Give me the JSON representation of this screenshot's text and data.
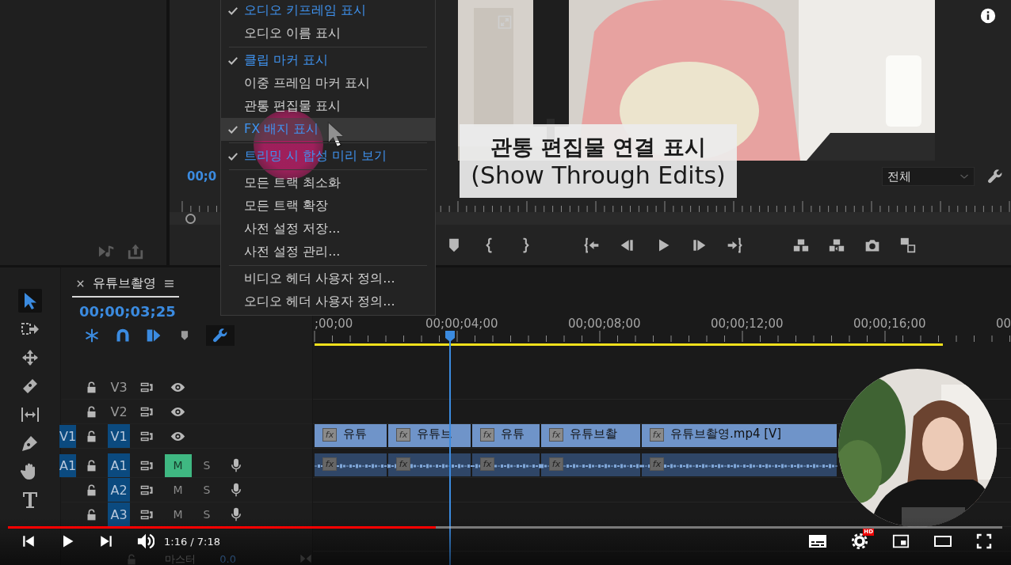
{
  "program_monitor": {
    "timecode": "00;0",
    "zoom": "전체"
  },
  "context_menu": {
    "sections": [
      {
        "items": [
          {
            "label": "오디오 키프레임 표시",
            "checked": true,
            "highlighted": false
          },
          {
            "label": "오디오 이름 표시",
            "checked": false,
            "highlighted": false
          }
        ]
      },
      {
        "items": [
          {
            "label": "클립 마커 표시",
            "checked": true,
            "highlighted": false
          },
          {
            "label": "이중 프레임 마커 표시",
            "checked": false,
            "highlighted": false
          },
          {
            "label": "관통 편집물 표시",
            "checked": false,
            "highlighted": false
          },
          {
            "label": "FX 배지 표시",
            "checked": true,
            "highlighted": true
          }
        ]
      },
      {
        "items": [
          {
            "label": "트리밍 시 합성 미리 보기",
            "checked": true,
            "highlighted": false
          }
        ]
      },
      {
        "items": [
          {
            "label": "모든 트랙 최소화",
            "checked": false,
            "highlighted": false
          },
          {
            "label": "모든 트랙 확장",
            "checked": false,
            "highlighted": false
          },
          {
            "label": "사전 설정 저장...",
            "checked": false,
            "highlighted": false
          },
          {
            "label": "사전 설정 관리...",
            "checked": false,
            "highlighted": false
          }
        ]
      },
      {
        "items": [
          {
            "label": "비디오 헤더 사용자 정의...",
            "checked": false,
            "highlighted": false
          },
          {
            "label": "오디오 헤더 사용자 정의...",
            "checked": false,
            "highlighted": false
          }
        ]
      }
    ]
  },
  "caption": {
    "title": "관통 편집물 연결 표시",
    "subtitle": "(Show Through Edits)"
  },
  "tools": [
    {
      "kind": "selection",
      "selected": true
    },
    {
      "kind": "track_select",
      "selected": false
    },
    {
      "kind": "ripple",
      "selected": false
    },
    {
      "kind": "razor",
      "selected": false
    },
    {
      "kind": "slip",
      "selected": false
    },
    {
      "kind": "pen",
      "selected": false
    },
    {
      "kind": "hand",
      "selected": false
    },
    {
      "kind": "type",
      "selected": false
    }
  ],
  "timeline": {
    "tab": {
      "title": "유튜브촬영",
      "selected": true
    },
    "timecode": "00;00;03;25",
    "toolbar": [
      {
        "kind": "nest",
        "on": true
      },
      {
        "kind": "snap",
        "on": true
      },
      {
        "kind": "linked",
        "on": true
      },
      {
        "kind": "marker",
        "on": false
      },
      {
        "kind": "settings",
        "on": true
      }
    ],
    "ruler": [
      ";00;00",
      "00;00;04;00",
      "00;00;08;00",
      "00;00;12;00",
      "00;00;16;00",
      "00"
    ],
    "tracks": [
      {
        "kind": "video",
        "name": "V3",
        "targeted": false
      },
      {
        "kind": "video",
        "name": "V2",
        "targeted": false
      },
      {
        "kind": "video",
        "source": "V1",
        "name": "V1",
        "targeted": true,
        "clips": [
          {
            "label": "유튜",
            "badge": "fx"
          },
          {
            "label": "유튜브",
            "badge": "fx"
          },
          {
            "label": "유튜",
            "badge": "fx"
          },
          {
            "label": "유튜브촬",
            "badge": "fx"
          },
          {
            "label": "유튜브촬영.mp4 [V]",
            "badge": "fx"
          }
        ]
      },
      {
        "kind": "audio",
        "source": "A1",
        "name": "A1",
        "targeted": true,
        "mute": {
          "label": "M",
          "on": true
        },
        "solo": {
          "label": "S",
          "on": false
        },
        "clips": [
          {
            "badge": "fx"
          },
          {
            "badge": "fx"
          },
          {
            "badge": "fx"
          },
          {
            "badge": "fx"
          },
          {
            "badge": "fx"
          }
        ]
      },
      {
        "kind": "audio",
        "name": "A2",
        "targeted": true,
        "mute": {
          "label": "M",
          "on": false
        },
        "solo": {
          "label": "S",
          "on": false
        }
      },
      {
        "kind": "audio",
        "name": "A3",
        "targeted": true,
        "mute": {
          "label": "M",
          "on": false
        },
        "solo": {
          "label": "S",
          "on": false
        }
      },
      {
        "kind": "master",
        "name": "마스터",
        "volume": "0.0"
      }
    ]
  },
  "player": {
    "playing": false,
    "progress": {
      "level": 0.43
    },
    "time": "1:16 / 7:18",
    "hd_badge": "HD"
  }
}
